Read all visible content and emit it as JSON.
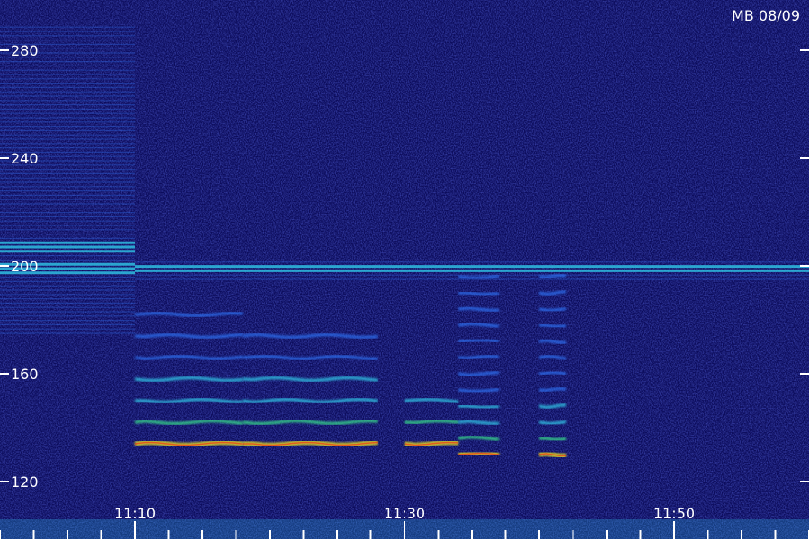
{
  "chart_data": {
    "type": "heatmap",
    "title": "MB 08/09",
    "xlabel": "",
    "ylabel": "",
    "y_tick_labels": [
      "120",
      "160",
      "200",
      "240",
      "280"
    ],
    "y_ticks": [
      120,
      160,
      200,
      240,
      280
    ],
    "x_tick_labels": [
      "11:10",
      "11:30",
      "11:50"
    ],
    "x_ticks": [
      "11:10",
      "11:30",
      "11:50"
    ],
    "xlim": [
      "11:10",
      "11:60"
    ],
    "ylim": [
      108,
      295
    ],
    "colormap": [
      "#0c0c5c",
      "#1a2cc8",
      "#2f6ff0",
      "#30c8e8",
      "#38e08a",
      "#e8e020",
      "#e83018"
    ],
    "background_color": "#0c0c5c",
    "grid": false,
    "features": [
      {
        "kind": "interference_band",
        "t_start": "11:00",
        "t_end": "11:10",
        "freq_low": 175,
        "freq_high": 290
      },
      {
        "kind": "interference_band",
        "t_start": "11:10",
        "t_end": "11:60",
        "freq_low": 195,
        "freq_high": 202
      },
      {
        "kind": "harmonic_stack",
        "t_start": "11:10",
        "t_end": "11:18",
        "fundamental": 134,
        "spacing": 8,
        "count": 7
      },
      {
        "kind": "harmonic_stack",
        "t_start": "11:18",
        "t_end": "11:28",
        "fundamental": 134,
        "spacing": 8,
        "count": 6
      },
      {
        "kind": "harmonic_stack",
        "t_start": "11:30",
        "t_end": "11:34",
        "fundamental": 134,
        "spacing": 8,
        "count": 3
      },
      {
        "kind": "harmonic_stack",
        "t_start": "11:34",
        "t_end": "11:37",
        "fundamental": 130,
        "spacing": 6,
        "count": 12
      },
      {
        "kind": "harmonic_stack",
        "t_start": "11:40",
        "t_end": "11:42",
        "fundamental": 130,
        "spacing": 6,
        "count": 12
      }
    ]
  }
}
